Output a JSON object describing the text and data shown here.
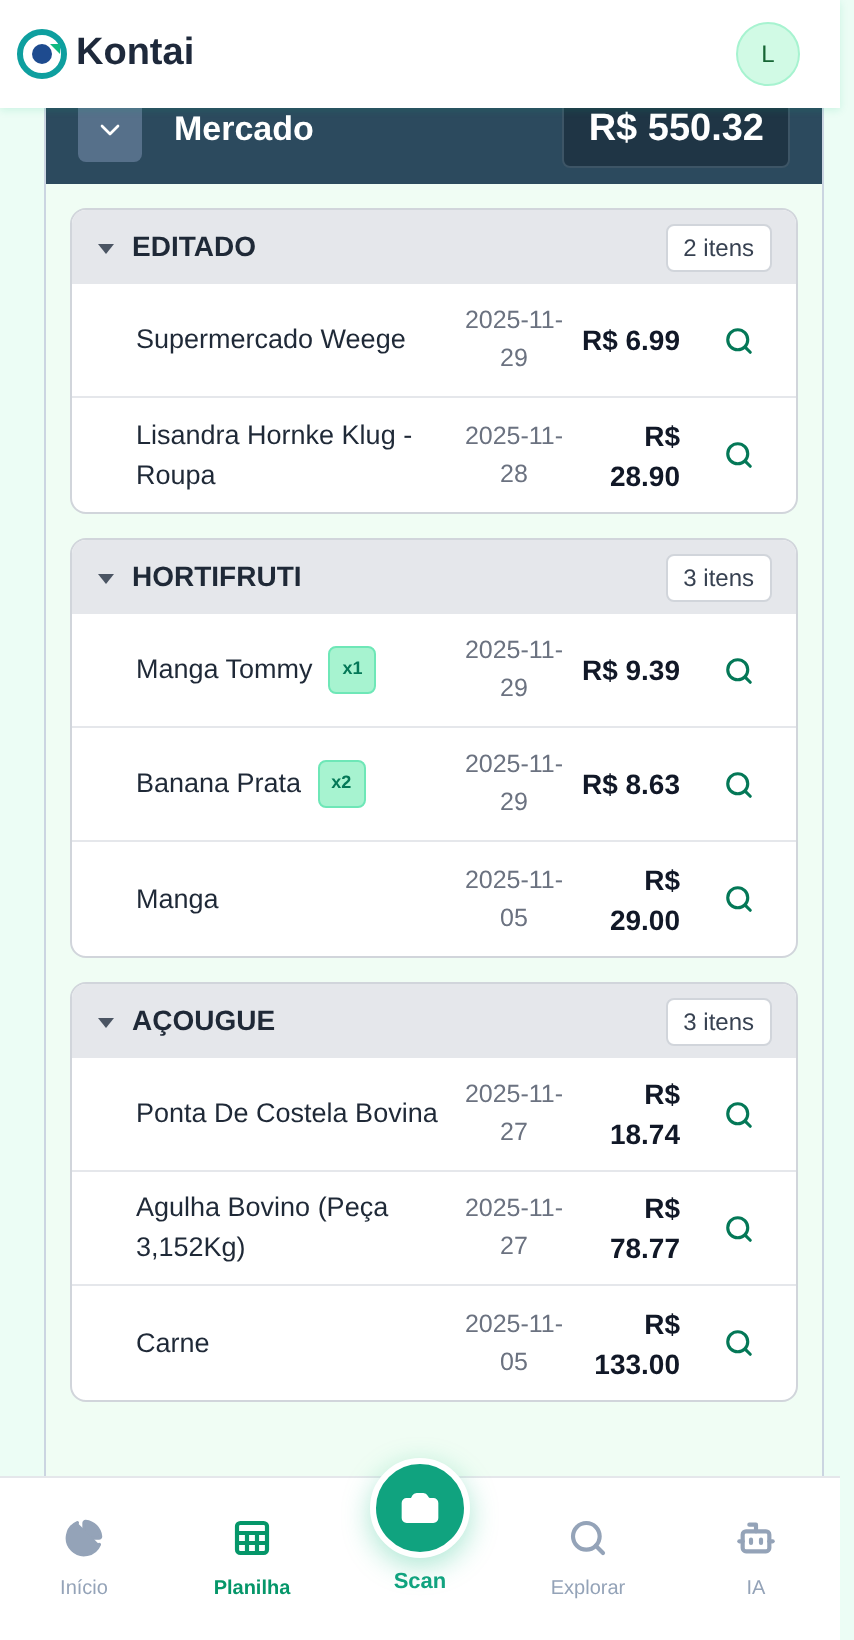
{
  "app": {
    "brand": "Kontai",
    "avatar": "L"
  },
  "category": {
    "title": "Mercado",
    "total": "R$ 550.32",
    "expanded": true
  },
  "groups": [
    {
      "title": "EDITADO",
      "count": "2 itens",
      "expanded": true,
      "items": [
        {
          "name": "Supermercado Weege",
          "date": "2025-11-29",
          "price": "R$ 6.99"
        },
        {
          "name": "Lisandra Hornke Klug - Roupa",
          "date": "2025-11-28",
          "price": "R$ 28.90"
        }
      ]
    },
    {
      "title": "HORTIFRUTI",
      "count": "3 itens",
      "expanded": true,
      "items": [
        {
          "name": "Manga Tommy",
          "quantity": "x1",
          "date": "2025-11-29",
          "price": "R$ 9.39"
        },
        {
          "name": "Banana Prata",
          "quantity": "x2",
          "date": "2025-11-29",
          "price": "R$ 8.63"
        },
        {
          "name": "Manga",
          "date": "2025-11-05",
          "price": "R$ 29.00"
        }
      ]
    },
    {
      "title": "AÇOUGUE",
      "count": "3 itens",
      "expanded": true,
      "items": [
        {
          "name": "Ponta De Costela Bovina",
          "date": "2025-11-27",
          "price": "R$ 18.74"
        },
        {
          "name": "Agulha Bovino (Peça 3,152Kg)",
          "date": "2025-11-27",
          "price": "R$ 78.77"
        },
        {
          "name": "Carne",
          "date": "2025-11-05",
          "price": "R$ 133.00"
        }
      ]
    }
  ],
  "nav": [
    {
      "kind": "home",
      "label": "Início",
      "selected": false
    },
    {
      "kind": "sheet",
      "label": "Planilha",
      "selected": true
    },
    {
      "kind": "scan",
      "label": "Scan",
      "selected": false
    },
    {
      "kind": "explore",
      "label": "Explorar",
      "selected": false
    },
    {
      "kind": "ai",
      "label": "IA",
      "selected": false
    }
  ]
}
